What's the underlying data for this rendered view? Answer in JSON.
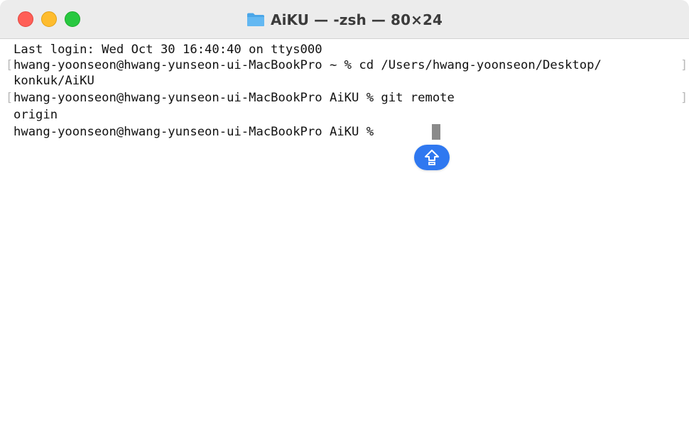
{
  "window": {
    "title": "AiKU — -zsh — 80×24",
    "title_icon": "folder-icon",
    "controls": [
      {
        "name": "close",
        "color": "#ff5f57"
      },
      {
        "name": "minimize",
        "color": "#febc2e"
      },
      {
        "name": "zoom",
        "color": "#28c840"
      }
    ]
  },
  "terminal": {
    "lines": [
      "Last login: Wed Oct 30 16:40:40 on ttys000",
      "hwang-yoonseon@hwang-yunseon-ui-MacBookPro ~ % cd /Users/hwang-yoonseon/Desktop/",
      "konkuk/AiKU",
      "hwang-yoonseon@hwang-yunseon-ui-MacBookPro AiKU % git remote",
      "origin",
      "hwang-yoonseon@hwang-yunseon-ui-MacBookPro AiKU % "
    ],
    "bracket_open": "[",
    "bracket_close": "]"
  },
  "floating_button": {
    "icon": "caps-lock-icon",
    "color": "#2f78f0"
  }
}
